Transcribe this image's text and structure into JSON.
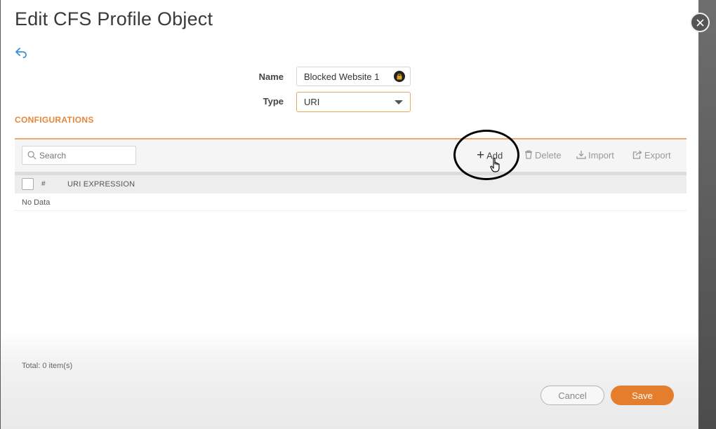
{
  "dialog": {
    "title": "Edit CFS Profile Object"
  },
  "form": {
    "name_label": "Name",
    "name_value": "Blocked Website 1",
    "type_label": "Type",
    "type_value": "URI"
  },
  "configurations": {
    "section_title": "CONFIGURATIONS",
    "search_placeholder": "Search",
    "actions": {
      "add": "Add",
      "delete": "Delete",
      "import": "Import",
      "export": "Export"
    },
    "table": {
      "columns": [
        "#",
        "URI EXPRESSION"
      ],
      "empty_text": "No Data"
    },
    "total_text": "Total: 0 item(s)"
  },
  "footer": {
    "cancel_label": "Cancel",
    "save_label": "Save"
  },
  "icons": {
    "back": "back-arrow-icon",
    "lock": "lock-icon",
    "dropdown": "chevron-down-icon",
    "search": "search-icon",
    "add": "plus-icon",
    "delete": "trash-icon",
    "import": "import-icon",
    "export": "export-icon",
    "close": "close-icon",
    "cursor": "hand-pointer-icon"
  },
  "colors": {
    "accent": "#e8863a",
    "save_button": "#e57e2c",
    "link_blue": "#3a8fd8"
  }
}
